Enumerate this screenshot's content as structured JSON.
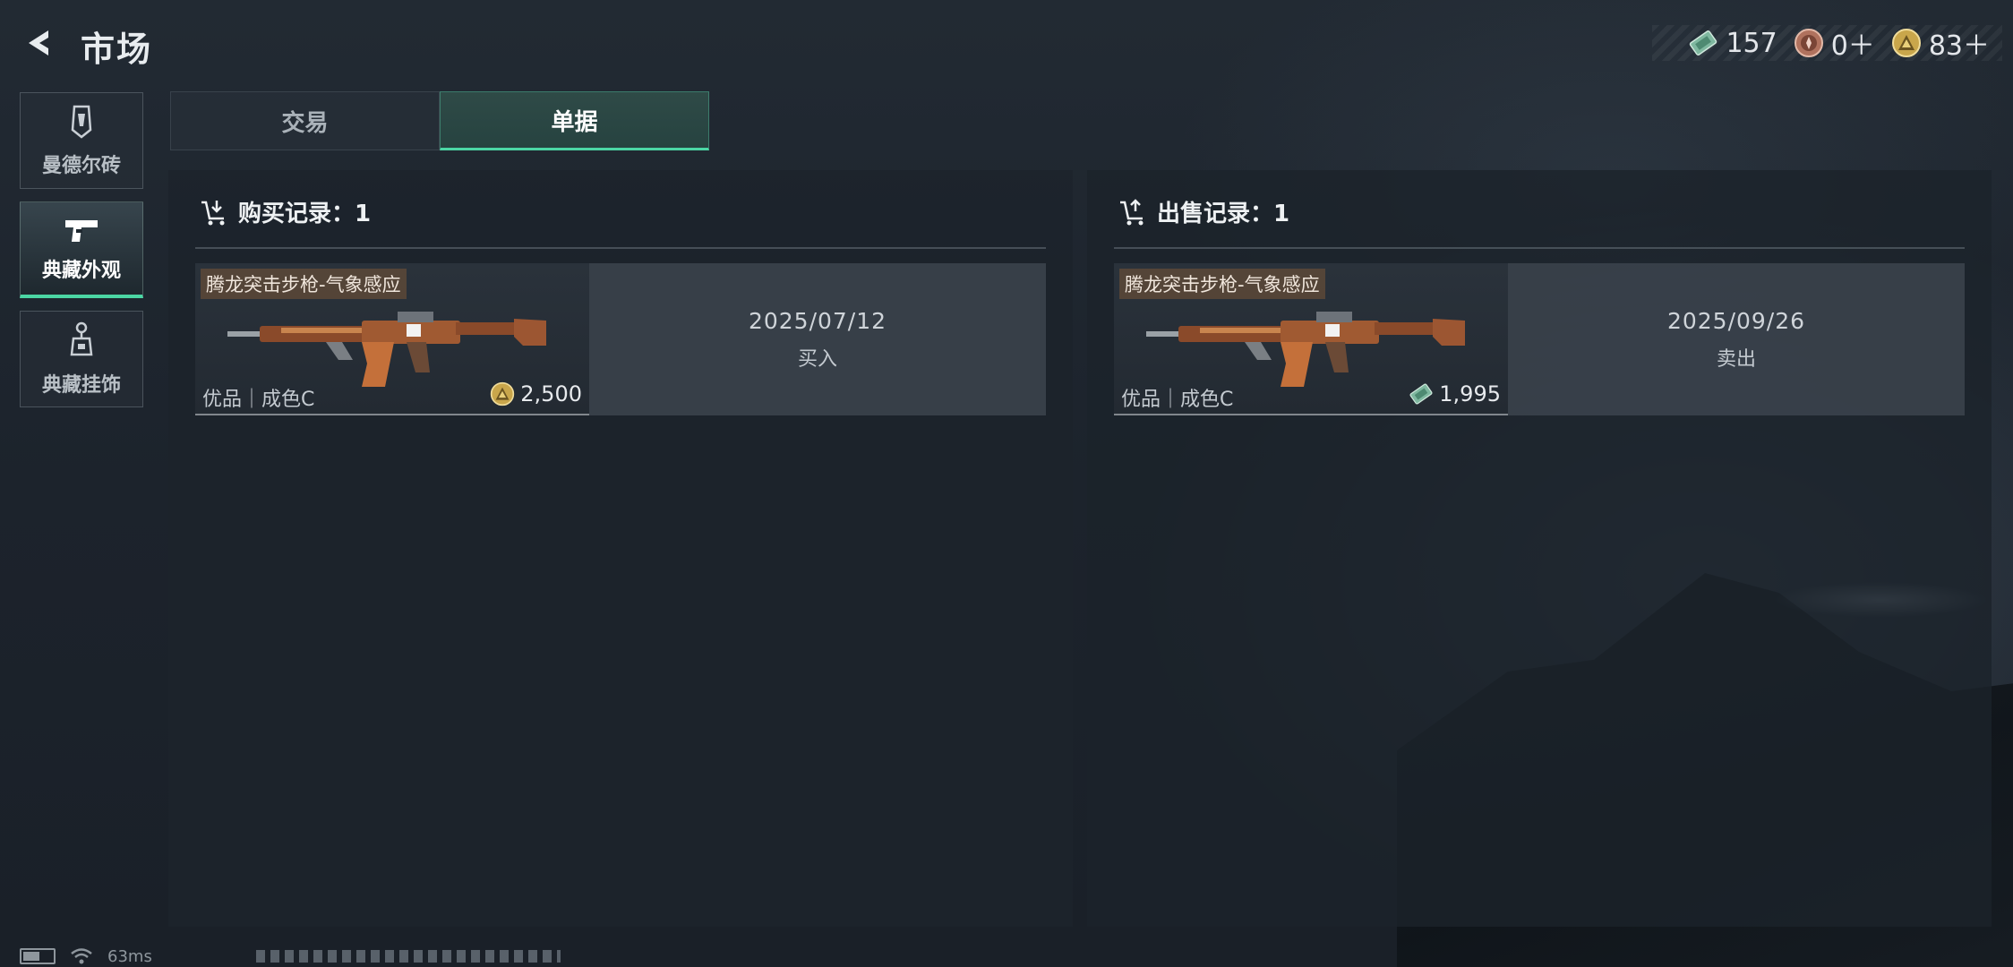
{
  "header": {
    "title": "市场",
    "back_icon": "back-arrow-icon",
    "currencies": [
      {
        "icon": "voucher-icon",
        "value": "157"
      },
      {
        "icon": "bronze-coin-icon",
        "value": "0＋"
      },
      {
        "icon": "gold-coin-icon",
        "value": "83＋"
      }
    ]
  },
  "sidebar": {
    "items": [
      {
        "label": "曼德尔砖",
        "icon": "brick-icon",
        "active": false
      },
      {
        "label": "典藏外观",
        "icon": "pistol-icon",
        "active": true
      },
      {
        "label": "典藏挂饰",
        "icon": "charm-icon",
        "active": false
      }
    ]
  },
  "tabs": [
    {
      "label": "交易",
      "active": false
    },
    {
      "label": "单据",
      "active": true
    }
  ],
  "purchase_panel": {
    "title": "购买记录：1",
    "icon": "cart-download-icon",
    "records": [
      {
        "item_name": "腾龙突击步枪-气象感应",
        "grade": "优品｜成色C",
        "price": "2,500",
        "price_icon": "gold-coin-icon",
        "date": "2025/07/12",
        "action": "买入"
      }
    ]
  },
  "sale_panel": {
    "title": "出售记录：1",
    "icon": "cart-upload-icon",
    "records": [
      {
        "item_name": "腾龙突击步枪-气象感应",
        "grade": "优品｜成色C",
        "price": "1,995",
        "price_icon": "voucher-icon",
        "date": "2025/09/26",
        "action": "卖出"
      }
    ]
  },
  "status_bar": {
    "latency": "63ms"
  },
  "colors": {
    "accent": "#4bd6a4",
    "background": "#1c232c",
    "panel": "#1c232b",
    "record_info_bg": "#3c444e",
    "name_tag_bg": "#78553a"
  }
}
